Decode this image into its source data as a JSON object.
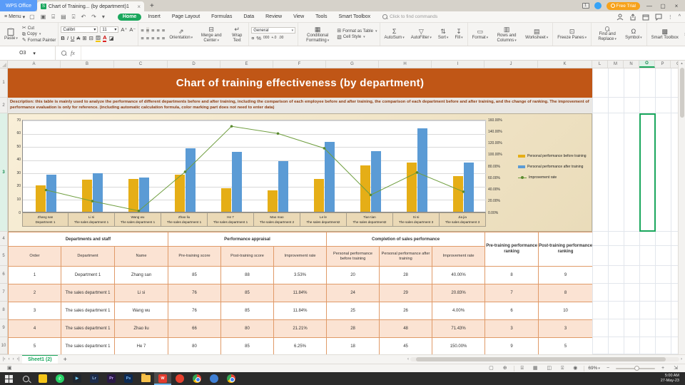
{
  "window": {
    "app": "WPS Office",
    "doc_tab": "Chart of Training... (by department)1",
    "badge": "1",
    "free_trial": "Free Trial"
  },
  "menu": {
    "label": "Menu"
  },
  "tabs": [
    "Home",
    "Insert",
    "Page Layout",
    "Formulas",
    "Data",
    "Review",
    "View",
    "Tools",
    "Smart Toolbox"
  ],
  "search": {
    "placeholder": "Click to find commands"
  },
  "icons": {
    "menu": "≡",
    "caret": "▾",
    "open": "▢",
    "save": "▣",
    "output": "⌸",
    "print": "▤",
    "preview": "⌻",
    "undo": "↶",
    "redo": "↷",
    "more-tools": "▾",
    "cut": "✂",
    "copy": "⧉",
    "painter": "✎",
    "border": "⊞",
    "mergecells": "⊟",
    "fillcolor": "▨",
    "eraser": "◪",
    "align": "≡",
    "orientation": "⇗",
    "wrap": "↵",
    "money": "¤",
    "percent": "%",
    "thousand": "000",
    "dec-add": "+.0",
    "dec-sub": ".00",
    "cond": "▦",
    "astable": "⊞",
    "cstyle": "▧",
    "sum": "Σ",
    "filter": "▽",
    "sort": "⇅",
    "fillseries": "↧",
    "formatcells": "▭",
    "rowscols": "▥",
    "worksheet": "▤",
    "freeze": "⊡",
    "symbol": "Ω",
    "toolbox": "▩",
    "collapse": "›",
    "more": "⋮",
    "chevron-up": "^",
    "fontup": "A",
    "fontdown": "A",
    "bold": "B",
    "italic": "I",
    "underline": "U",
    "strike": "A",
    "plus": "+",
    "minus": "−",
    "close": "×",
    "restore": "▢",
    "minimize": "—",
    "nav-first": "|‹",
    "nav-prev": "‹",
    "nav-next": "›",
    "nav-last": "›|",
    "harrow-left": "‹",
    "harrow-right": "›",
    "varrow-up": "▴",
    "st-page": "▢",
    "st-target": "⊕",
    "st-normal": "⌸",
    "st-grid": "▦",
    "st-split": "◫",
    "st-layout": "⌻",
    "st-eye": "◉",
    "st-expand": "⇲",
    "macro": "▣",
    "doc": "S"
  },
  "ribbon": {
    "paste": "Paste",
    "cut": "Cut",
    "copy": "Copy",
    "format_painter": "Format Painter",
    "font_name": "Calibri",
    "font_size": "11",
    "orientation": "Orientation",
    "merge_center": "Merge and Center",
    "wrap_text": "Wrap Text",
    "number_format": "General",
    "conditional_formatting": "Conditional Formatting",
    "format_as_table": "Format as Table",
    "cell_style": "Cell Style",
    "autosum": "AutoSum",
    "autofilter": "AutoFilter",
    "sort": "Sort",
    "fill": "Fill",
    "format": "Format",
    "rows_columns": "Rows and Columns",
    "worksheet": "Worksheet",
    "freeze_panes": "Freeze Panes",
    "find_replace": "Find and Replace",
    "symbol": "Symbol",
    "smart_toolbox": "Smart Toolbox"
  },
  "formula_bar": {
    "name_box": "O3",
    "fx": "fx",
    "value": ""
  },
  "grid": {
    "columns": [
      "A",
      "B",
      "C",
      "D",
      "E",
      "F",
      "G",
      "H",
      "I",
      "J",
      "K",
      "L",
      "M",
      "N",
      "O",
      "P",
      "Q"
    ],
    "rows": [
      "1",
      "2",
      "3",
      "4",
      "5",
      "6",
      "7",
      "8",
      "9",
      "10"
    ],
    "selected_column": "O",
    "selected_row": "3"
  },
  "sheet": {
    "title": "Chart of training effectiveness (by department)",
    "description": "Description: this table is mainly used to analyze the performance of different departments before and after training, including the comparison of each employee before and after training, the comparison of each department before and after training, and the change of ranking. The improvement of performance evaluation is only for reference. (including automatic calculation formula, color marking part does not need to enter data)",
    "table": {
      "group_headers": [
        {
          "label": "Departments and staff",
          "span": 3
        },
        {
          "label": "Performance appraisal",
          "span": 3
        },
        {
          "label": "Completion of sales performance",
          "span": 3
        }
      ],
      "ranking_headers": [
        "Pre-training performance ranking",
        "Post-training performance ranking"
      ],
      "columns": [
        "Order",
        "Department",
        "Name",
        "Pre-training score",
        "Post-training score",
        "Improvement rate",
        "Personal performance before training",
        "Personal performance after training",
        "Improvement rate"
      ],
      "rows": [
        [
          "1",
          "Department 1",
          "Zhang san",
          "85",
          "88",
          "3.53%",
          "20",
          "28",
          "40.00%",
          "8",
          "9"
        ],
        [
          "2",
          "The sales department 1",
          "Li si",
          "76",
          "85",
          "11.84%",
          "24",
          "29",
          "20.83%",
          "7",
          "8"
        ],
        [
          "3",
          "The sales department 1",
          "Wang wu",
          "76",
          "85",
          "11.84%",
          "25",
          "26",
          "4.00%",
          "6",
          "10"
        ],
        [
          "4",
          "The sales department 1",
          "Zhao liu",
          "66",
          "80",
          "21.21%",
          "28",
          "48",
          "71.43%",
          "3",
          "3"
        ],
        [
          "5",
          "The sales department 1",
          "He 7",
          "80",
          "85",
          "6.25%",
          "18",
          "45",
          "150.00%",
          "9",
          "5"
        ]
      ]
    }
  },
  "chart_data": {
    "type": "bar",
    "categories": [
      [
        "Zhang san",
        "Department 1"
      ],
      [
        "Li si",
        "The sales department 1"
      ],
      [
        "Wang wu",
        "The sales department 1"
      ],
      [
        "Zhao liu",
        "The sales department 1"
      ],
      [
        "He 7",
        "The sales department 1"
      ],
      [
        "Mao mao",
        "The sales department 2"
      ],
      [
        "Le le",
        "The sales department2"
      ],
      [
        "Tian tian",
        "The sales department2"
      ],
      [
        "Si si",
        "The sales department 3"
      ],
      [
        "Jia jia",
        "The sales department 3"
      ]
    ],
    "series": [
      {
        "name": "Personal performance before training",
        "type": "bar",
        "color": "#e5ae17",
        "axis": "left",
        "values": [
          20,
          24,
          25,
          28,
          18,
          16,
          25,
          35,
          37,
          27
        ]
      },
      {
        "name": "Personal performance after training",
        "type": "bar",
        "color": "#5b9bd5",
        "axis": "left",
        "values": [
          28,
          29,
          26,
          48,
          45,
          38,
          53,
          46,
          63,
          37
        ]
      },
      {
        "name": "Improvement rate",
        "type": "line",
        "color": "#6f9e3f",
        "axis": "right",
        "values": [
          40,
          20.83,
          4,
          71.43,
          150,
          137.5,
          112,
          31.43,
          70.27,
          37.04
        ]
      }
    ],
    "left_axis": {
      "min": 0,
      "max": 70,
      "step": 10
    },
    "right_axis": {
      "min": 0,
      "max": 160,
      "step": 20,
      "suffix": "%",
      "decimals": 2
    },
    "legend_position": "right",
    "grid": true,
    "title": ""
  },
  "sheet_bar": {
    "sheet_name": "Sheet1 (2)"
  },
  "status_bar": {
    "zoom": "69%"
  },
  "taskbar": {
    "clock_time": "5:00 AM",
    "clock_date": "27-May-23",
    "items": [
      {
        "name": "start-button",
        "kind": "start"
      },
      {
        "name": "taskbar-search",
        "kind": "search"
      },
      {
        "name": "sticky-notes",
        "kind": "square",
        "color": "#f5c518",
        "text": "",
        "textColor": "#7a5c00"
      },
      {
        "name": "whatsapp",
        "kind": "circle",
        "color": "#25d366",
        "text": "✆",
        "textColor": "#ffffff"
      },
      {
        "name": "video-player",
        "kind": "square",
        "color": "#20262e",
        "text": "▶",
        "textColor": "#6cc7f0"
      },
      {
        "name": "lightroom",
        "kind": "square",
        "color": "#1c2b4a",
        "text": "Lr",
        "textColor": "#9bc1e8"
      },
      {
        "name": "premiere",
        "kind": "square",
        "color": "#2a1a45",
        "text": "Pr",
        "textColor": "#c5a3ff"
      },
      {
        "name": "photoshop",
        "kind": "square",
        "color": "#0d2a52",
        "text": "Ps",
        "textColor": "#7ab6f5"
      },
      {
        "name": "file-explorer",
        "kind": "folder"
      },
      {
        "name": "wps-office",
        "kind": "square",
        "color": "#e33b2e",
        "text": "W",
        "textColor": "#ffffff",
        "active": true
      },
      {
        "name": "red-app",
        "kind": "circle",
        "color": "#e7402e",
        "text": "",
        "textColor": "#ffffff"
      },
      {
        "name": "chrome",
        "kind": "chrome"
      },
      {
        "name": "blue-app",
        "kind": "circle",
        "color": "#3f7fd4",
        "text": "",
        "textColor": "#ffffff"
      },
      {
        "name": "chrome-profile",
        "kind": "chrome"
      }
    ]
  }
}
